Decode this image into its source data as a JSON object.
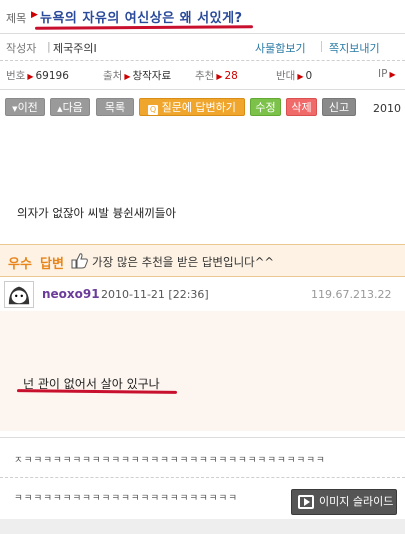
{
  "post": {
    "title_label": "제목",
    "title": "뉴욕의 자유의 여신상은 왜 서있게?",
    "author_label": "작성자",
    "author_name": "제국주의I",
    "view_posts": "사물함보기",
    "send_note": "쪽지보내기",
    "number_label": "번호",
    "number": "69196",
    "source_label": "출처",
    "source": "창작자료",
    "recommend_label": "추천",
    "recommend": "28",
    "oppose_label": "반대",
    "oppose": "0",
    "ip_label": "IP",
    "body": "의자가 없잖아 씨발 븅쉰새끼들아"
  },
  "toolbar": {
    "prev": "이전",
    "next": "다음",
    "list": "목록",
    "answer": "질문에 답변하기",
    "edit": "수정",
    "delete": "삭제",
    "report": "신고",
    "date": "2010"
  },
  "best_answer": {
    "label_a": "우수",
    "label_b": "답변",
    "desc": "가장 많은 추천을 받은 답변입니다^^",
    "user": "neoxo91",
    "time": "2010-11-21 [22:36]",
    "ip": "119.67.213.22",
    "text": "넌 관이 없어서 살아 있구나"
  },
  "comments": [
    "ㅈㅋㅋㅋㅋㅋㅋㅋㅋㅋㅋㅋㅋㅋㅋㅋㅋㅋㅋㅋㅋㅋㅋㅋㅋㅋㅋㅋㅋㅋㅋㅋ",
    "ㅋㅋㅋㅋㅋㅋㅋㅋㅋㅋㅋㅋㅋㅋㅋㅋㅋㅋㅋㅋㅋㅋㅋ"
  ],
  "slide_button": "이미지 슬라이드",
  "colors": {
    "title": "#2a4a9a",
    "underline": "#c8102e",
    "best": "#e8851a",
    "user": "#6b3c9a"
  }
}
